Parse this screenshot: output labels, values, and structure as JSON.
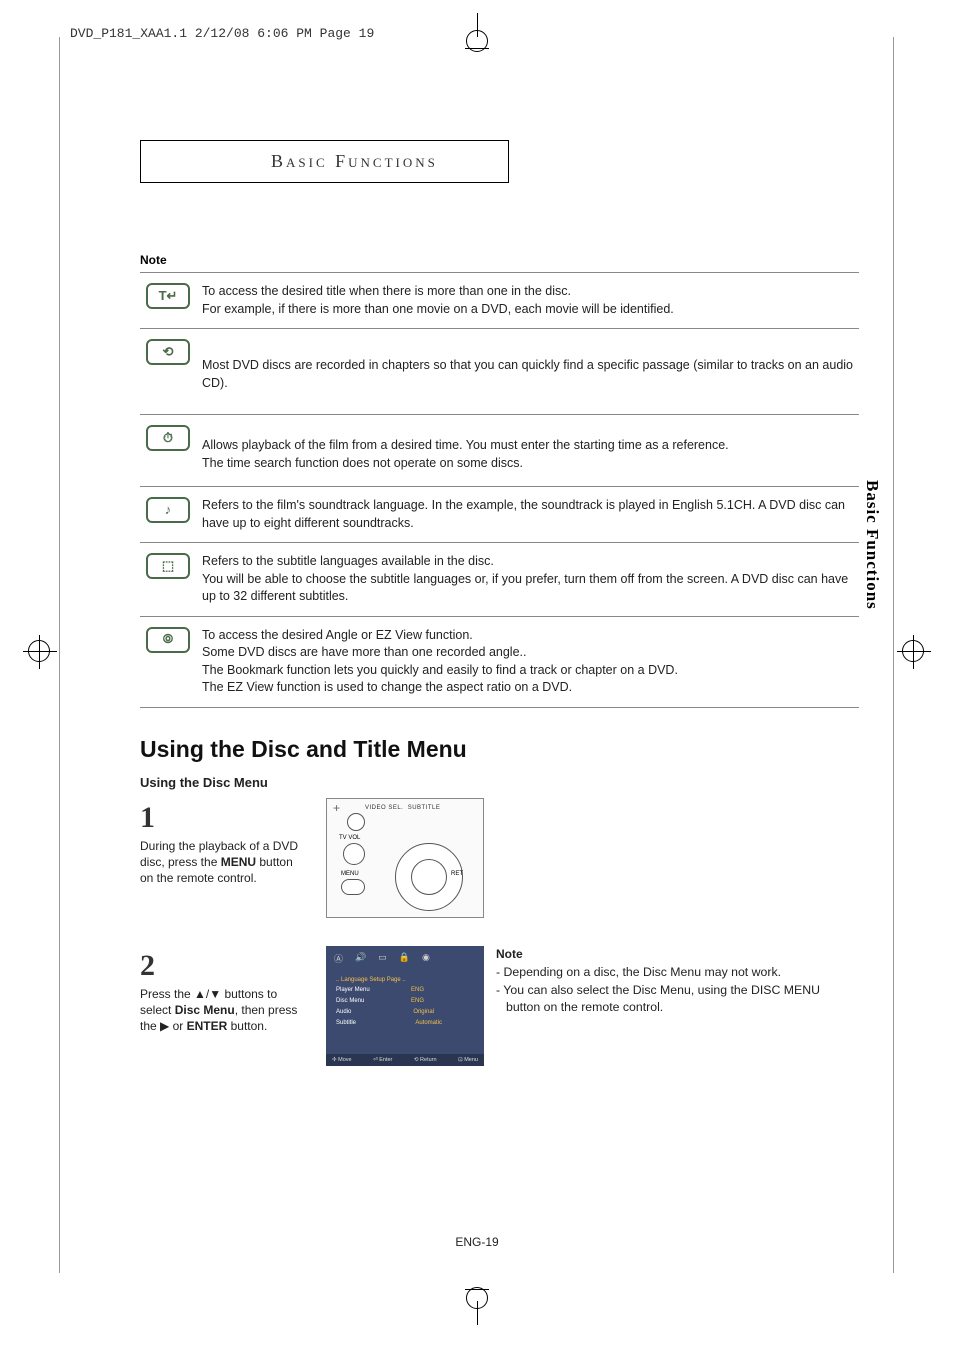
{
  "headerLine": "DVD_P181_XAA1.1  2/12/08  6:06 PM  Page 19",
  "chapterTitle": "Basic Functions",
  "noteLabel": "Note",
  "sideTab": "Basic Functions",
  "pageNum": "ENG-19",
  "icons": {
    "title": "T↵",
    "chapter": "⟲",
    "time": "⏱",
    "audio": "♪",
    "subtitle": "⬚",
    "angle": "⦾"
  },
  "rows": [
    "To access the desired title when there is more than one in the disc.\nFor example, if there is more than one movie on a DVD, each movie will be identified.",
    "Most DVD discs are recorded in chapters so that you can quickly find a specific passage (similar to tracks on an audio CD).",
    "Allows playback of the film from a desired time. You must enter the starting time as a reference.\nThe time search function does not operate on some discs.",
    "Refers to the film's soundtrack language. In the example, the soundtrack is played in English 5.1CH. A DVD disc can have up to eight different soundtracks.",
    "Refers to the subtitle languages available in the disc.\nYou will be able to choose the subtitle languages or, if you prefer, turn them off from the screen. A DVD disc can have up to 32 different subtitles.",
    "To access the desired Angle or EZ View  function.\nSome DVD discs are have more than one recorded angle..\nThe Bookmark function lets you quickly and easily to find a track or chapter on a DVD.\nThe EZ View function is used to change the aspect ratio on a DVD."
  ],
  "heading": "Using the Disc and Title Menu",
  "subheading": "Using the Disc Menu",
  "step1": {
    "num": "1",
    "textParts": [
      "During the playback of a DVD disc, press the ",
      "MENU",
      " button on the remote control."
    ],
    "remote": {
      "videoSel": "VIDEO SEL.",
      "subtitle": "SUBTITLE",
      "tvVol": "TV VOL",
      "menu": "MENU",
      "ret": "RET"
    }
  },
  "step2": {
    "num": "2",
    "textParts": [
      "Press the ▲/▼ buttons to select ",
      "Disc Menu",
      ", then press the ▶ or ",
      "ENTER",
      " button."
    ],
    "menu": {
      "title": ".. Language Setup Page ..",
      "items": [
        {
          "l": "Player Menu",
          "r": "ENG"
        },
        {
          "l": "Disc Menu",
          "r": "ENG"
        },
        {
          "l": "Audio",
          "r": "Original"
        },
        {
          "l": "Subtitle",
          "r": "Automatic"
        }
      ],
      "footer": [
        "✢ Move",
        "⏎ Enter",
        "⟲ Return",
        "⊡ Menu"
      ]
    }
  },
  "rightNote": {
    "title": "Note",
    "items": [
      "Depending on a disc, the Disc Menu may not work.",
      "You can also select the Disc Menu, using the DISC MENU button on the remote control."
    ]
  }
}
